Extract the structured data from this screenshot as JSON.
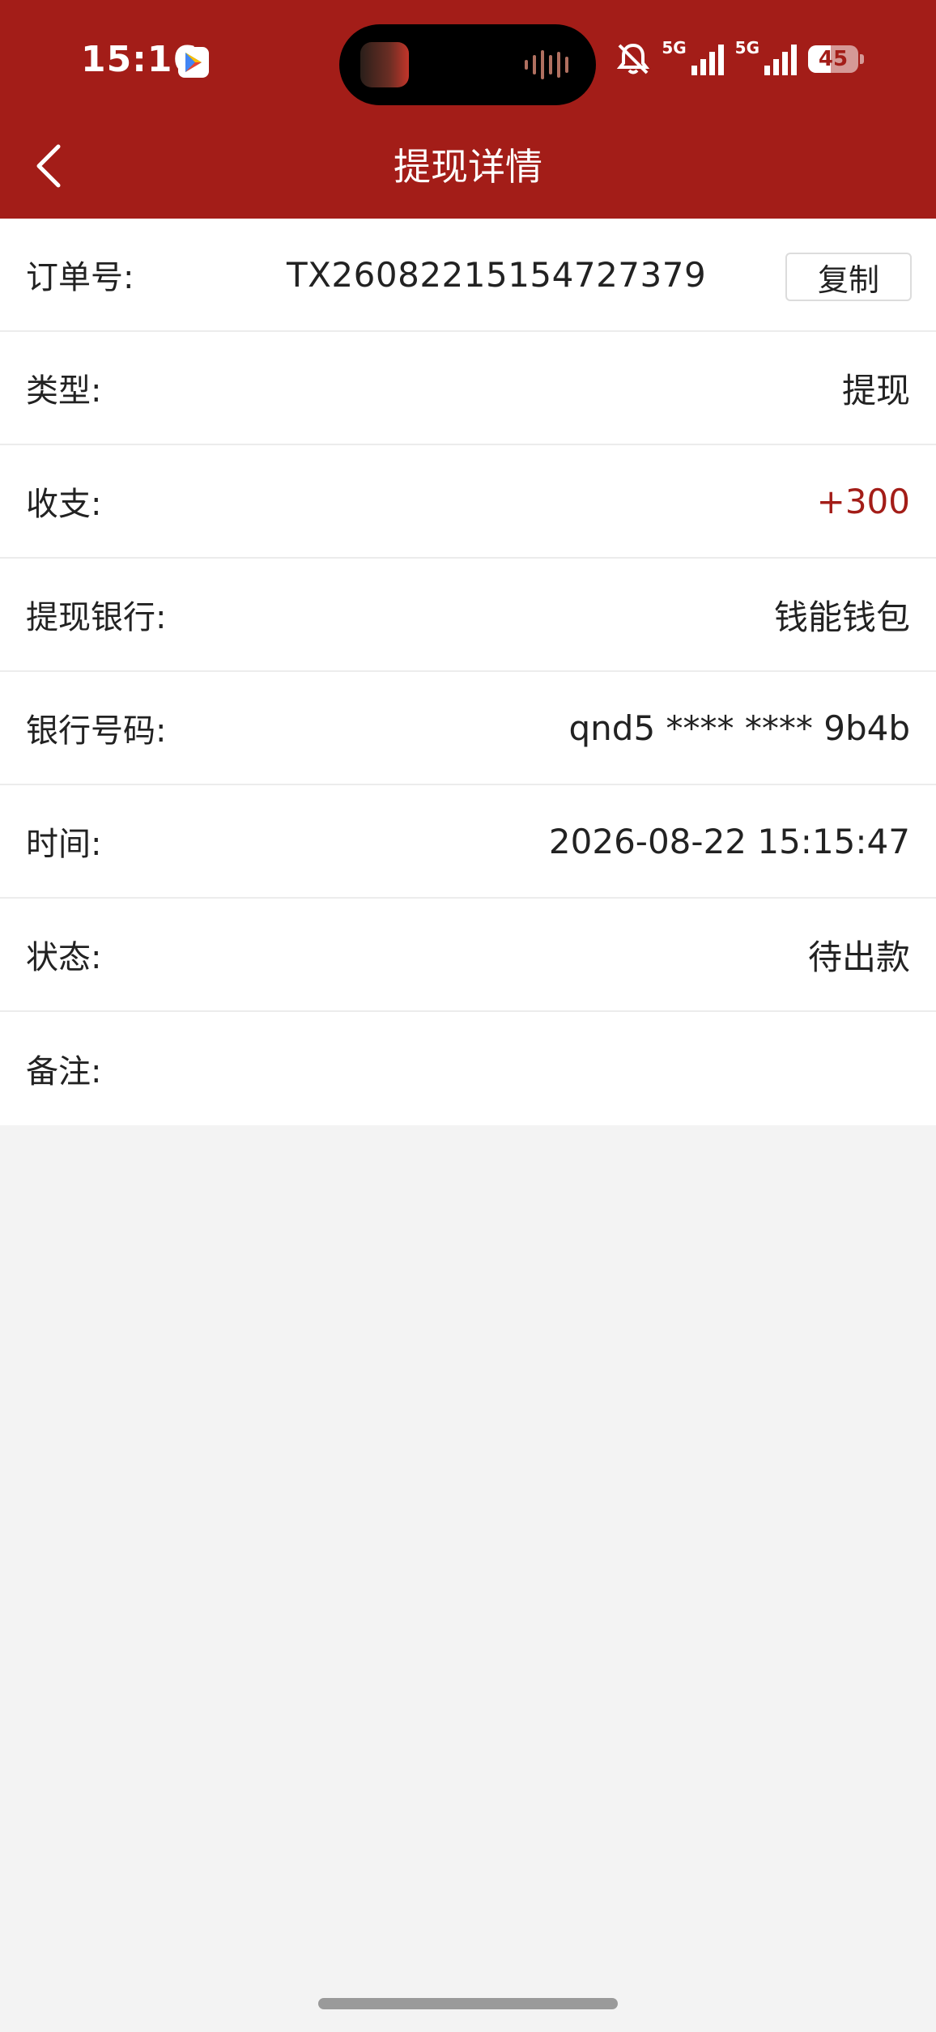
{
  "status_bar": {
    "time": "15:16",
    "network_1": "5G",
    "network_2": "5G",
    "battery_level": "45",
    "battery_fraction": 0.45
  },
  "nav": {
    "title": "提现详情"
  },
  "details": {
    "order": {
      "label": "订单号:",
      "value": "TX26082215154727379",
      "copy_label": "复制"
    },
    "type": {
      "label": "类型:",
      "value": "提现"
    },
    "amount": {
      "label": "收支:",
      "value": "+300"
    },
    "bank": {
      "label": "提现银行:",
      "value": "钱能钱包"
    },
    "account": {
      "label": "银行号码:",
      "value": "qnd5 **** **** 9b4b"
    },
    "time": {
      "label": "时间:",
      "value": "2026-08-22 15:15:47"
    },
    "status": {
      "label": "状态:",
      "value": "待出款"
    },
    "remark": {
      "label": "备注:",
      "value": ""
    }
  },
  "colors": {
    "brand": "#a31d18",
    "income": "#a31d18",
    "background": "#f3f3f3"
  }
}
